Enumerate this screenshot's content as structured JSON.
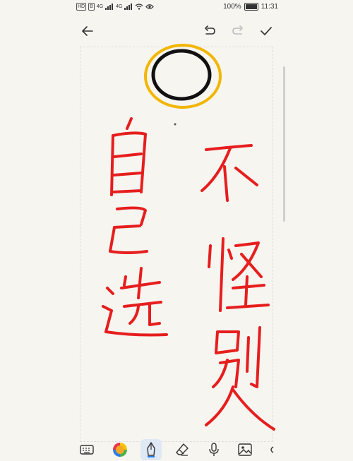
{
  "status_bar": {
    "left_chip_1": "HD",
    "left_chip_2": "B",
    "network_1": "4G",
    "network_2": "4G",
    "battery": "100%",
    "time": "11:31"
  },
  "icons": {
    "back": "arrow-left-icon",
    "undo": "undo-icon",
    "redo": "redo-icon",
    "done": "checkmark-icon",
    "keyboard": "keyboard-icon",
    "color": "color-wheel-icon",
    "pen": "pen-icon",
    "eraser": "eraser-icon",
    "mic": "microphone-icon",
    "image": "image-icon"
  },
  "colors": {
    "ink_red": "#e61e1e",
    "ink_black": "#111111",
    "ink_yellow": "#f2b600",
    "active_tool_bg": "#dfe8f5"
  }
}
